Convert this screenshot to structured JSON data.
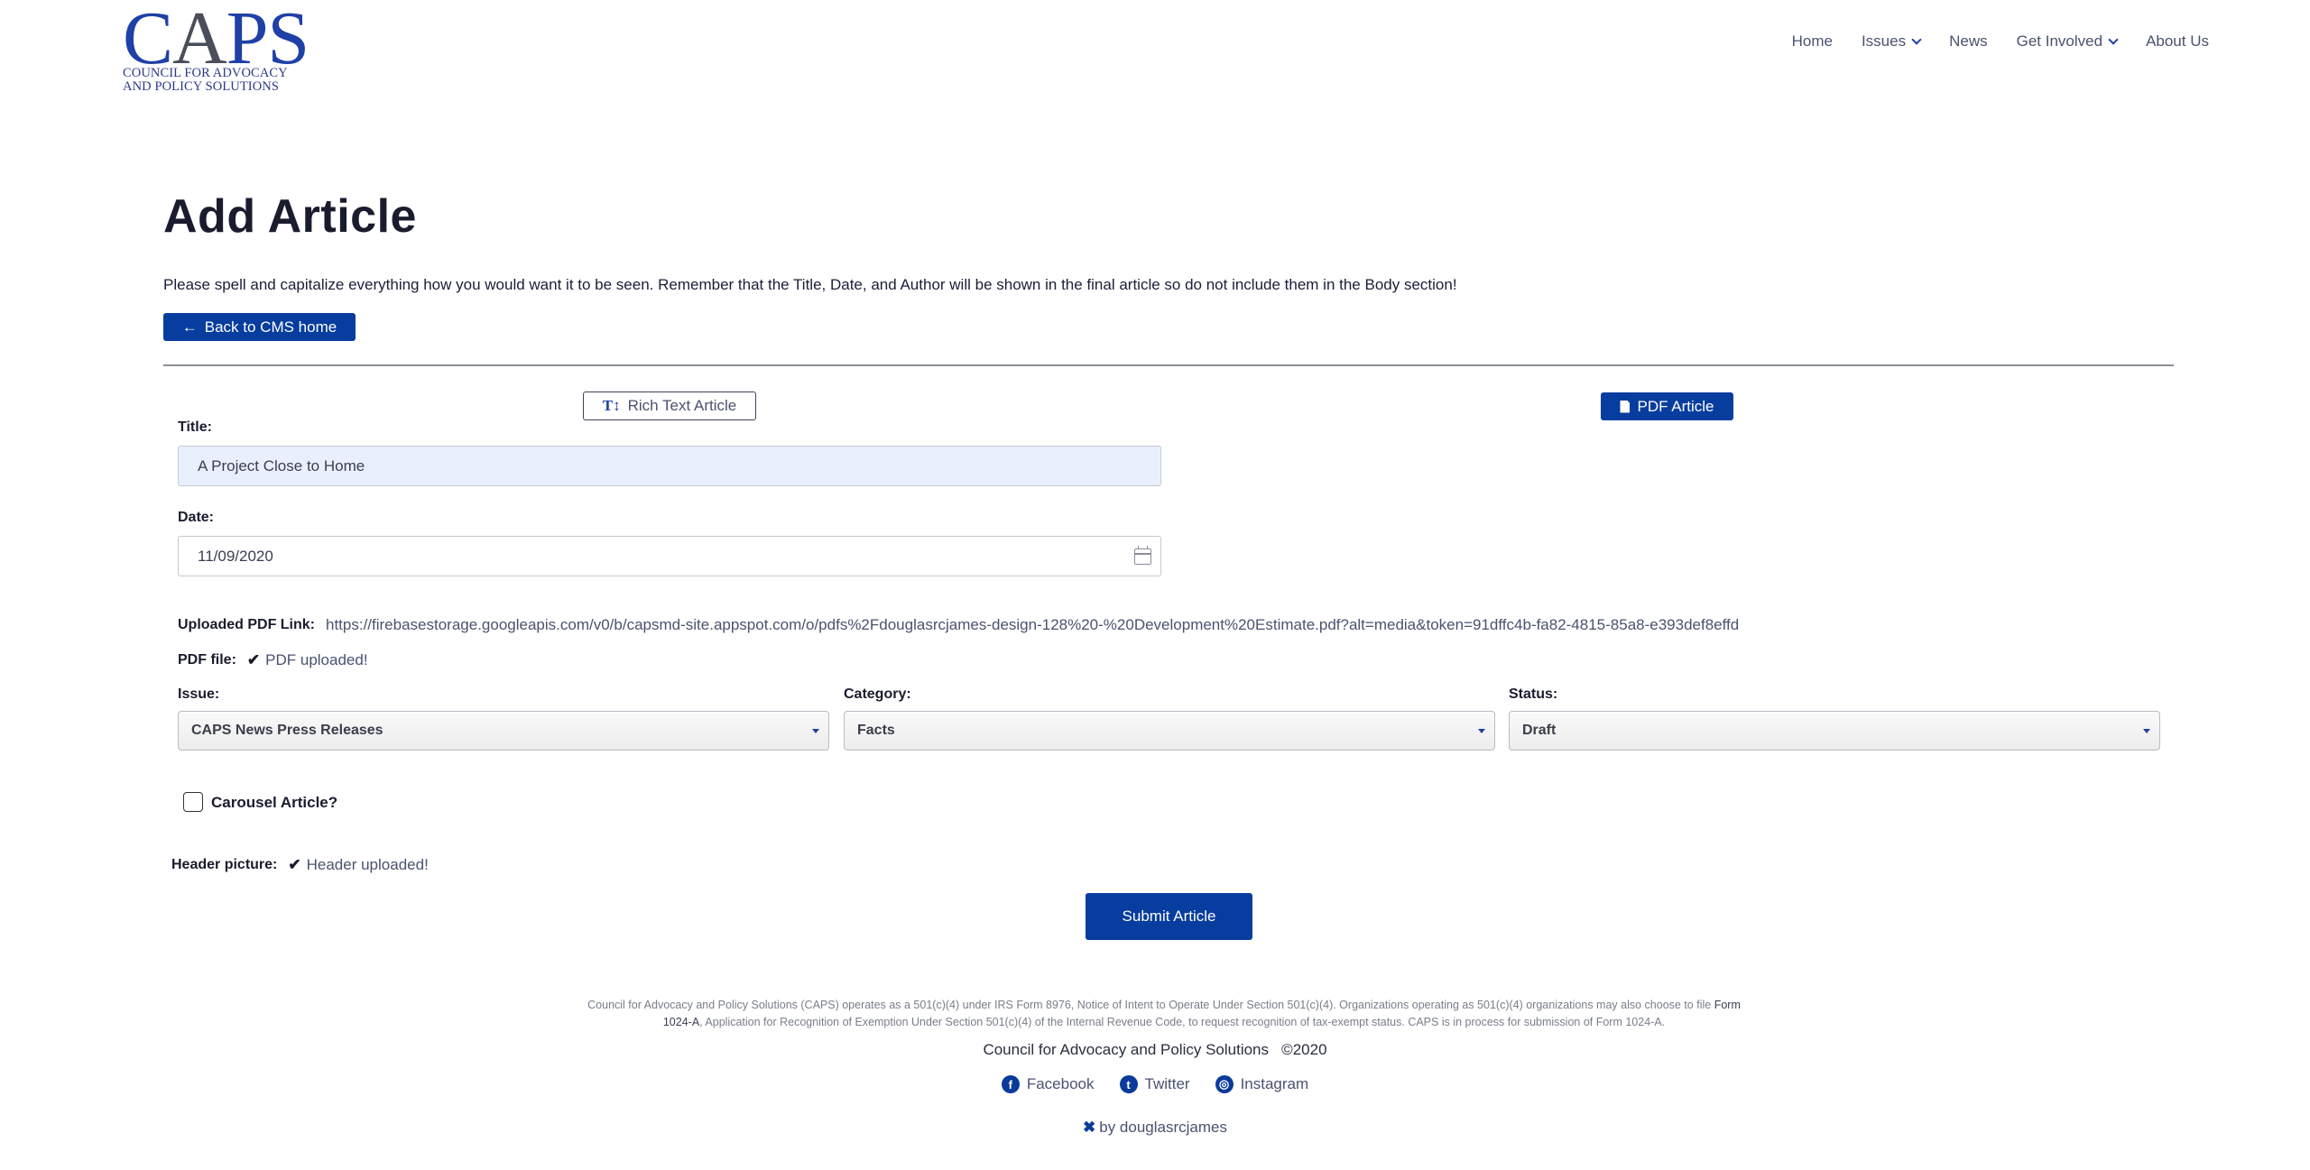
{
  "header": {
    "logo": {
      "wordmark": "CAPS",
      "wordmark_pre": "C",
      "wordmark_a": "A",
      "wordmark_post": "PS",
      "subtitle_line1": "COUNCIL FOR ADVOCACY",
      "subtitle_line2": "AND POLICY SOLUTIONS"
    },
    "nav": [
      {
        "label": "Home",
        "has_dropdown": false
      },
      {
        "label": "Issues",
        "has_dropdown": true
      },
      {
        "label": "News",
        "has_dropdown": false
      },
      {
        "label": "Get Involved",
        "has_dropdown": true
      },
      {
        "label": "About Us",
        "has_dropdown": false
      }
    ]
  },
  "main": {
    "title": "Add Article",
    "intro": "Please spell and capitalize everything how you would want it to be seen. Remember that the Title, Date, and Author will be shown in the final article so do not include them in the Body section!",
    "back_button": {
      "icon": "arrow-left-icon",
      "label": "Back to CMS home"
    },
    "mode_buttons": {
      "rich_text": {
        "icon": "text-height-icon",
        "icon_glyph": "T↕",
        "label": "Rich Text Article"
      },
      "pdf": {
        "icon": "file-pdf-icon",
        "label": "PDF Article"
      }
    },
    "form": {
      "title_label": "Title:",
      "title_value": "A Project Close to Home",
      "date_label": "Date:",
      "date_value": "11/09/2020",
      "pdf_link_label": "Uploaded PDF Link:",
      "pdf_link_value": "https://firebasestorage.googleapis.com/v0/b/capsmd-site.appspot.com/o/pdfs%2Fdouglasrcjames-design-128%20-%20Development%20Estimate.pdf?alt=media&token=91dffc4b-fa82-4815-85a8-e393def8effd",
      "pdf_file_label": "PDF file:",
      "pdf_file_status": "PDF uploaded!",
      "issue_label": "Issue:",
      "issue_value": "CAPS News Press Releases",
      "category_label": "Category:",
      "category_value": "Facts",
      "status_label": "Status:",
      "status_value": "Draft",
      "carousel_label": "Carousel Article?",
      "carousel_checked": false,
      "header_picture_label": "Header picture:",
      "header_picture_status": "Header uploaded!",
      "check_glyph": "✔",
      "submit_label": "Submit Article"
    }
  },
  "footer": {
    "disclaimer_part1": "Council for Advocacy and Policy Solutions (CAPS) operates as a 501(c)(4) under IRS Form 8976, Notice of Intent to Operate Under Section 501(c)(4). Organizations operating as 501(c)(4) organizations may also choose to file ",
    "disclaimer_form_link": "Form 1024-A",
    "disclaimer_part2": ", Application for Recognition of Exemption Under Section 501(c)(4) of the Internal Revenue Code, to request recognition of tax-exempt status. CAPS is in process for submission of Form 1024-A.",
    "copyright": "Council for Advocacy and Policy Solutions   ©2020",
    "socials": [
      {
        "icon": "facebook-icon",
        "glyph": "f",
        "label": "Facebook"
      },
      {
        "icon": "twitter-icon",
        "glyph": "t",
        "label": "Twitter"
      },
      {
        "icon": "instagram-icon",
        "glyph": "◎",
        "label": "Instagram"
      }
    ],
    "credit_icon_glyph": "✖",
    "credit": "by douglasrcjames"
  },
  "colors": {
    "brand_blue": "#073d9e",
    "title_input_bg": "#e8f0fd",
    "text_dark": "#1a1c2e",
    "text_muted": "#4a5270"
  }
}
